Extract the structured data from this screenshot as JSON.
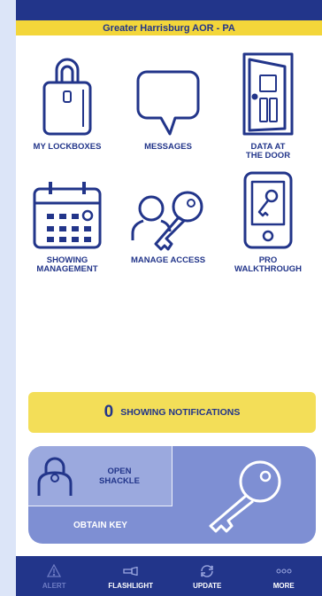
{
  "header": {
    "title": "Greater Harrisburg AOR - PA"
  },
  "tiles": [
    {
      "label": "MY LOCKBOXES",
      "icon": "lockbox-icon"
    },
    {
      "label": "MESSAGES",
      "icon": "speech-bubble-icon"
    },
    {
      "label": "DATA AT\nTHE DOOR",
      "icon": "open-door-icon"
    },
    {
      "label": "SHOWING\nMANAGEMENT",
      "icon": "calendar-icon"
    },
    {
      "label": "MANAGE ACCESS",
      "icon": "person-key-icon"
    },
    {
      "label": "PRO\nWALKTHROUGH",
      "icon": "phone-key-icon"
    }
  ],
  "notifications": {
    "count": "0",
    "label": "SHOWING NOTIFICATIONS"
  },
  "bluetooth": {
    "open_shackle": "OPEN\nSHACKLE",
    "obtain_key": "OBTAIN KEY"
  },
  "nav": [
    {
      "label": "ALERT",
      "icon": "warning-icon",
      "enabled": false
    },
    {
      "label": "FLASHLIGHT",
      "icon": "flashlight-icon",
      "enabled": true
    },
    {
      "label": "UPDATE",
      "icon": "sync-icon",
      "enabled": true
    },
    {
      "label": "MORE",
      "icon": "more-dots-icon",
      "enabled": true
    }
  ],
  "colors": {
    "primary": "#22358a",
    "accent": "#f3d63a",
    "panel": "#7e8fd3"
  }
}
